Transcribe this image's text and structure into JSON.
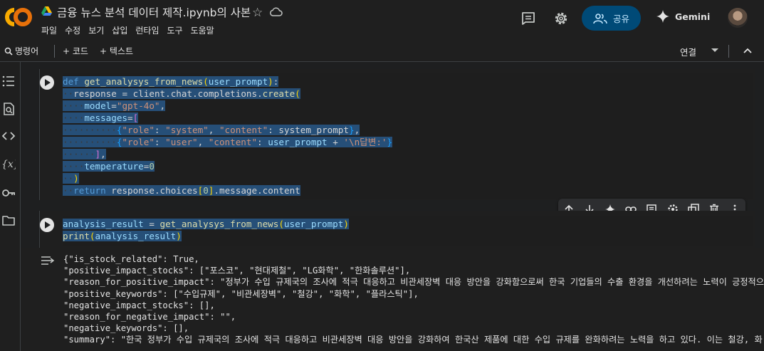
{
  "header": {
    "title": "금융 뉴스 분석 데이터 제작.ipynb의 사본",
    "menu": [
      "파일",
      "수정",
      "보기",
      "삽입",
      "런타임",
      "도구",
      "도움말"
    ],
    "share_label": "공유",
    "gemini_label": "Gemini",
    "icons": [
      "colab-logo",
      "drive-icon",
      "star-icon",
      "cloud-icon",
      "comment-icon",
      "settings-icon",
      "people-icon",
      "gemini-icon",
      "avatar"
    ]
  },
  "toolbar": {
    "commands_label": "명령어",
    "add_code_label": "+ 코드",
    "add_text_label": "+ 텍스트",
    "connect_label": "연결"
  },
  "cells": [
    {
      "type": "code",
      "lines": [
        "def get_analysys_from_news(user_prompt):",
        "  response = client.chat.completions.create(",
        "    model=\"gpt-4o\",",
        "    messages=[",
        "          {\"role\": \"system\", \"content\": system_prompt},",
        "          {\"role\": \"user\", \"content\": user_prompt + '\\n답변:'}",
        "      ],",
        "    temperature=0",
        "  )",
        "  return response.choices[0].message.content"
      ]
    },
    {
      "type": "code",
      "lines": [
        "analysis_result = get_analysys_from_news(user_prompt)",
        "print(analysis_result)"
      ],
      "output": [
        "{\"is_stock_related\": True,",
        "\"positive_impact_stocks\": [\"포스코\", \"현대제철\", \"LG화학\", \"한화솔루션\"],",
        "\"reason_for_positive_impact\": \"정부가 수입 규제국의 조사에 적극 대응하고 비관세장벽 대응 방안을 강화함으로써 한국 기업들의 수출 환경을 개선하려는 노력이 긍정적으",
        "\"positive_keywords\": [\"수입규제\", \"비관세장벽\", \"철강\", \"화학\", \"플라스틱\"],",
        "\"negative_impact_stocks\": [],",
        "\"reason_for_negative_impact\": \"\",",
        "\"negative_keywords\": [],",
        "\"summary\": \"한국 정부가 수입 규제국의 조사에 적극 대응하고 비관세장벽 대응 방안을 강화하여 한국산 제품에 대한 수입 규제를 완화하려는 노력을 하고 있다. 이는 철강, 화"
      ]
    }
  ],
  "cell_toolbar": [
    "arrow-up-icon",
    "arrow-down-icon",
    "sparkle-icon",
    "link-icon",
    "comment-icon",
    "settings-icon",
    "mirror-icon",
    "delete-icon",
    "more-icon"
  ],
  "colors": {
    "background": "#1e1f20",
    "share_bg": "#004a77",
    "selection": "#264f78",
    "keyword": "#569cd6",
    "string": "#ce9178"
  }
}
